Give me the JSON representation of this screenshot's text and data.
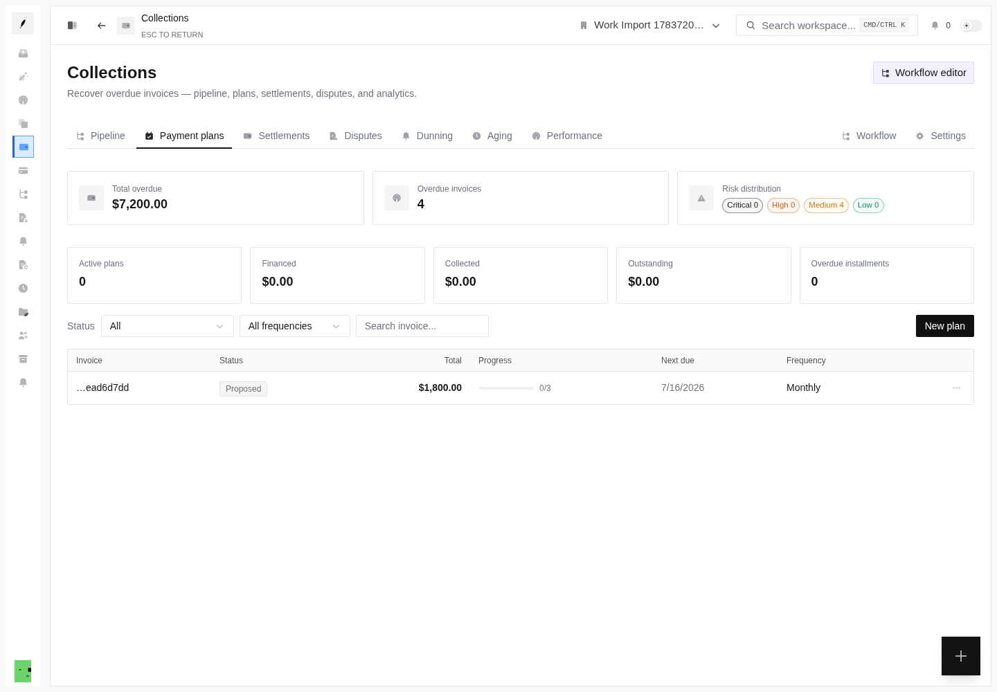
{
  "sidebar": {
    "items": [
      {
        "selected": false
      },
      {
        "selected": false
      },
      {
        "selected": false
      },
      {
        "selected": false
      },
      {
        "selected": true
      },
      {
        "selected": false
      },
      {
        "selected": false
      },
      {
        "selected": false
      },
      {
        "selected": false
      },
      {
        "selected": false
      },
      {
        "selected": false
      },
      {
        "selected": false
      },
      {
        "selected": false
      },
      {
        "selected": false
      },
      {
        "selected": false
      }
    ]
  },
  "top_bar": {
    "title": "Collections",
    "hint": "ESC TO RETURN",
    "workspace": "Work Import 1783720…",
    "search": {
      "placeholder": "Search workspace...",
      "shortcut": "CMD/CTRL K"
    },
    "notifications": "0",
    "dark_mode": false
  },
  "header": {
    "title": "Collections",
    "subtitle": "Recover overdue invoices — pipeline, plans, settlements, disputes, and analytics.",
    "action": "Workflow editor"
  },
  "tabs": [
    {
      "label": "Pipeline",
      "selected": false
    },
    {
      "label": "Payment plans",
      "selected": true
    },
    {
      "label": "Settlements",
      "selected": false
    },
    {
      "label": "Disputes",
      "selected": false
    },
    {
      "label": "Dunning",
      "selected": false
    },
    {
      "label": "Aging",
      "selected": false
    },
    {
      "label": "Performance",
      "selected": false
    }
  ],
  "side_tabs": [
    {
      "label": "Workflow",
      "selected": false
    },
    {
      "label": "Settings",
      "selected": false
    }
  ],
  "summary_cards": [
    {
      "kind": "value",
      "label": "Total overdue",
      "value": "$7,200.00"
    },
    {
      "kind": "value",
      "label": "Overdue invoices",
      "value": "4"
    },
    {
      "kind": "badges",
      "label": "Risk distribution",
      "badges": [
        {
          "label": "Critical 0",
          "color": "#171717"
        },
        {
          "label": "High 0",
          "color": "#ea580c"
        },
        {
          "label": "Medium 4",
          "color": "#d97706"
        },
        {
          "label": "Low 0",
          "color": "#059669"
        }
      ]
    }
  ],
  "plan_stats": [
    {
      "label": "Active plans",
      "value": "0"
    },
    {
      "label": "Financed",
      "value": "$0.00"
    },
    {
      "label": "Collected",
      "value": "$0.00"
    },
    {
      "label": "Outstanding",
      "value": "$0.00"
    },
    {
      "label": "Overdue installments",
      "value": "0"
    }
  ],
  "filters": {
    "status_label": "Status",
    "status": "All",
    "frequency": "All frequencies",
    "search": {
      "placeholder": "Search invoice..."
    },
    "new_button": "New plan"
  },
  "table": {
    "columns": [
      "Invoice",
      "Status",
      "Total",
      "Progress",
      "Next due",
      "Frequency"
    ],
    "rows": [
      {
        "invoice": "…ead6d7dd",
        "status": "Proposed",
        "total": "$1,800.00",
        "progress": {
          "level": 0,
          "reading": "0/3"
        },
        "next_due": "7/16/2026",
        "frequency": "Monthly"
      }
    ]
  }
}
